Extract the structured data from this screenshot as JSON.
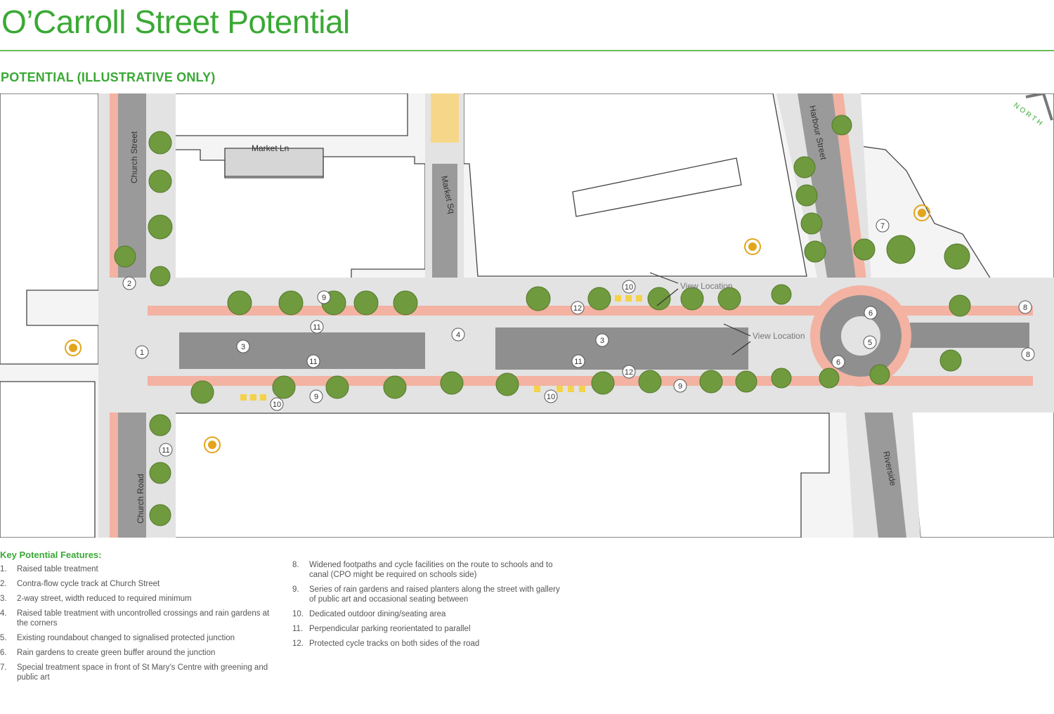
{
  "page": {
    "title": "O’Carroll Street Potential",
    "subtitle": "POTENTIAL (ILLUSTRATIVE ONLY)"
  },
  "map": {
    "north_label": "NORTH",
    "street_labels": {
      "church_street": "Church Street",
      "market_ln": "Market Ln",
      "market_sq": "Market Sq",
      "harbour_street": "Harbour Street",
      "church_road": "Church Road",
      "riverside": "Riverside"
    },
    "view_location_label": "View Location",
    "markers": [
      "1",
      "2",
      "3",
      "3",
      "4",
      "5",
      "6",
      "6",
      "7",
      "8",
      "8",
      "9",
      "9",
      "9",
      "10",
      "10",
      "10",
      "11",
      "11",
      "11",
      "11",
      "12",
      "12"
    ],
    "colors": {
      "cycle_track": "#f3b2a2",
      "road": "#9a9a9a",
      "footpath": "#e3e3e3",
      "tree": "#6f9a3e",
      "accent_green": "#3aa935",
      "landmark": "#e3a51c",
      "seating": "#f4d24a"
    }
  },
  "legend": {
    "heading": "Key Potential Features:",
    "items": [
      {
        "num": "1.",
        "text": "Raised table treatment"
      },
      {
        "num": "2.",
        "text": "Contra-flow cycle track at Church Street"
      },
      {
        "num": "3.",
        "text": "2-way street, width reduced to required minimum"
      },
      {
        "num": "4.",
        "text": "Raised table treatment with uncontrolled crossings and rain gardens at",
        "text2": "the corners"
      },
      {
        "num": "5.",
        "text": "Existing  roundabout changed to signalised protected junction"
      },
      {
        "num": "6.",
        "text": "Rain gardens to create green buffer around the junction"
      },
      {
        "num": "7.",
        "text": "Special treatment space in front of St Mary’s Centre with greening and",
        "text2": "public art"
      },
      {
        "num": "8.",
        "text": "Widened footpaths and cycle facilities on the route to schools and to",
        "text2": "canal  (CPO might be required on schools side)"
      },
      {
        "num": "9.",
        "text": "Series of rain gardens and raised planters along the street with gallery",
        "text2": "of public art and occasional seating between"
      },
      {
        "num": "10.",
        "text": "Dedicated outdoor dining/seating area"
      },
      {
        "num": "11.",
        "text": "Perpendicular parking reorientated to parallel"
      },
      {
        "num": "12.",
        "text": "Protected cycle tracks on both sides of the road"
      }
    ]
  }
}
